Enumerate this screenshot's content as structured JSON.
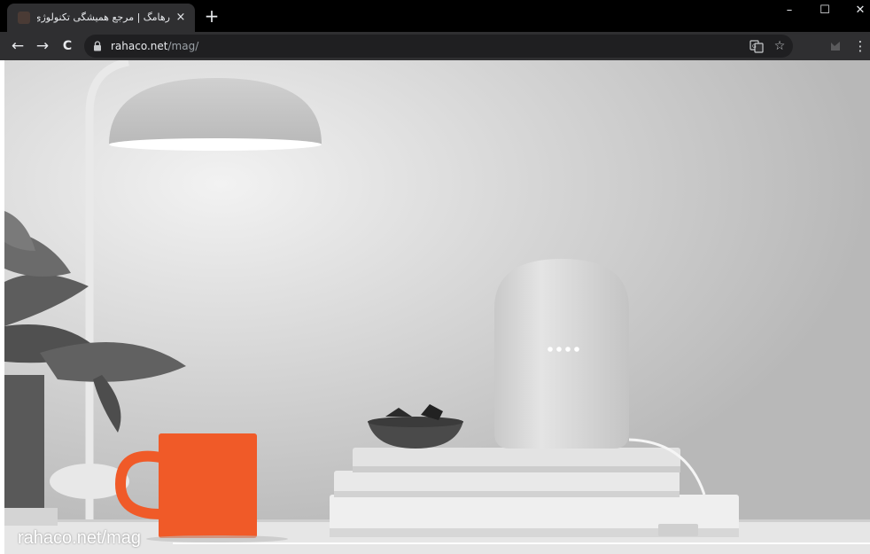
{
  "browser": {
    "tab": {
      "title": "رهامگ | مرجع همیشگی تکنولوژی |",
      "close_icon": "×",
      "favicon": "rahamag-favicon-icon"
    },
    "new_tab_icon": "+",
    "window_controls": {
      "minimize": "–",
      "maximize": "☐",
      "close": "✕"
    },
    "toolbar": {
      "back_icon": "←",
      "forward_icon": "→",
      "reload_icon": "C",
      "url_host": "rahaco.net",
      "url_path": "/mag/",
      "translate_icon": "translate-icon",
      "bookmark_icon": "☆",
      "menu_icon": "⋮"
    }
  },
  "page": {
    "watermark": "rahaco.net/mag",
    "colors": {
      "mug": "#f05a28",
      "wall": "#cfcfcf",
      "speaker": "#d9d9d9"
    }
  }
}
